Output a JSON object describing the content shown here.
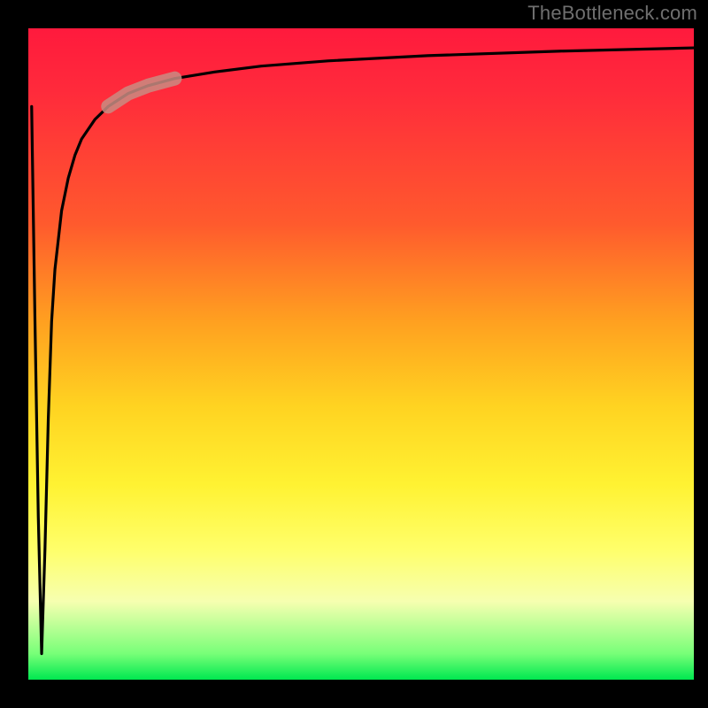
{
  "attribution": "TheBottleneck.com",
  "colors": {
    "gradient_top": "#ff1a3d",
    "gradient_mid1": "#ffa020",
    "gradient_mid2": "#fff232",
    "gradient_bottom": "#00e850",
    "frame": "#000000",
    "curve": "#000000",
    "highlight": "#c98c82"
  },
  "chart_data": {
    "type": "line",
    "title": "",
    "xlabel": "",
    "ylabel": "",
    "xlim": [
      0,
      100
    ],
    "ylim": [
      0,
      100
    ],
    "grid": false,
    "legend": false,
    "series": [
      {
        "name": "bottleneck-curve",
        "x": [
          0.5,
          1.0,
          1.5,
          2.0,
          2.5,
          3.0,
          3.5,
          4.0,
          5.0,
          6.0,
          7.0,
          8.0,
          10.0,
          12.0,
          15.0,
          18.0,
          22.0,
          28.0,
          35.0,
          45.0,
          60.0,
          80.0,
          100.0
        ],
        "y": [
          88.0,
          55.0,
          25.0,
          4.0,
          20.0,
          40.0,
          55.0,
          63.0,
          72.0,
          77.0,
          80.5,
          83.0,
          86.0,
          88.0,
          90.0,
          91.2,
          92.3,
          93.3,
          94.2,
          95.0,
          95.8,
          96.5,
          97.0
        ]
      }
    ],
    "highlight_segment": {
      "x_start": 12.0,
      "x_end": 22.0,
      "note": "emphasized portion of curve"
    }
  }
}
